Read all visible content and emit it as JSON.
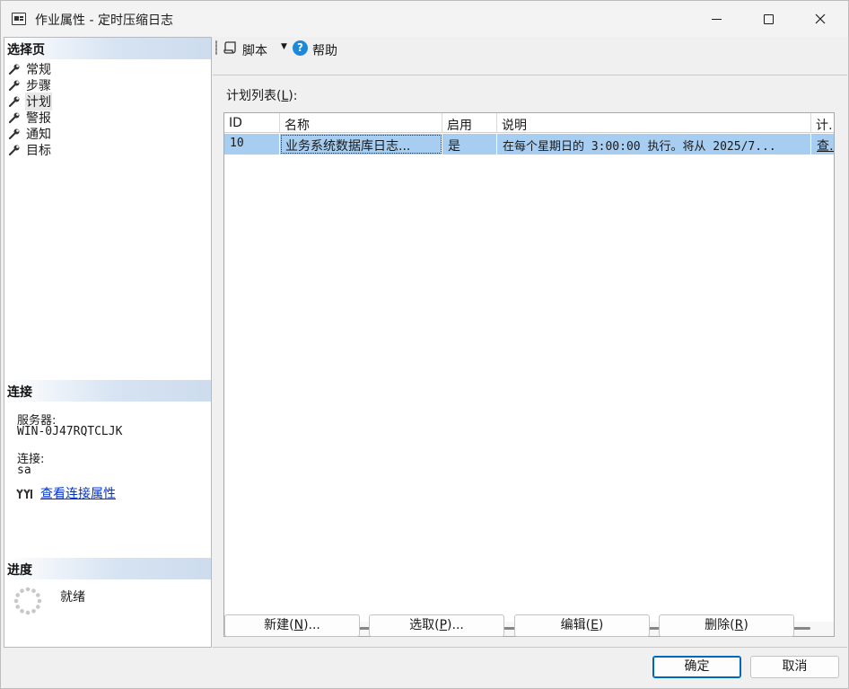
{
  "window": {
    "title": "作业属性 - 定时压缩日志"
  },
  "left": {
    "select_page_header": "选择页",
    "pages": [
      {
        "label": "常规"
      },
      {
        "label": "步骤"
      },
      {
        "label": "计划"
      },
      {
        "label": "警报"
      },
      {
        "label": "通知"
      },
      {
        "label": "目标"
      }
    ],
    "selected_page": "计划",
    "connection_header": "连接",
    "server_label": "服务器:",
    "server_value": "WIN-0J47RQTCLJK",
    "conn_label": "连接:",
    "conn_value": "sa",
    "conn_link": "查看连接属性",
    "progress_header": "进度",
    "progress_status": "就绪"
  },
  "toolbar": {
    "script_label": "脚本",
    "help_label": "帮助"
  },
  "schedule": {
    "list_label": "计划列表(",
    "list_label_key": "L",
    "list_label_end": "):",
    "columns": [
      "ID",
      "名称",
      "启用",
      "说明",
      "计…"
    ],
    "rows": [
      {
        "id": "10",
        "name": "业务系统数据库日志...",
        "enabled": "是",
        "description": "在每个星期日的 3:00:00 执行。将从 2025/7...",
        "extra": "查…"
      }
    ]
  },
  "buttons": {
    "new_prefix": "新建(",
    "new_key": "N",
    "new_suffix": ")...",
    "pick_prefix": "选取(",
    "pick_key": "P",
    "pick_suffix": ")...",
    "edit_prefix": "编辑(",
    "edit_key": "E",
    "edit_suffix": ")",
    "delete_prefix": "删除(",
    "delete_key": "R",
    "delete_suffix": ")",
    "ok": "确定",
    "cancel": "取消"
  },
  "colors": {
    "selection": "#a7cdf0",
    "header_gradient": "#cddcee",
    "link": "#0033cc",
    "help_icon": "#1e88d8"
  }
}
